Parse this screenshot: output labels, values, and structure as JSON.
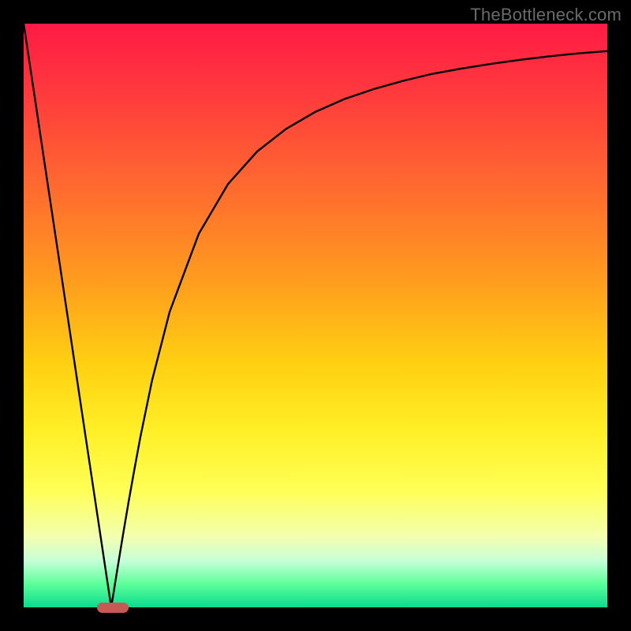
{
  "watermark": "TheBottleneck.com",
  "colors": {
    "frame": "#000000",
    "gradient_top": "#ff1a45",
    "gradient_bottom": "#0bdb8e",
    "curve": "#000000",
    "marker": "#c75955",
    "watermark": "#6a6a6a"
  },
  "chart_data": {
    "type": "line",
    "x": [
      0,
      2,
      4,
      6,
      8,
      10,
      12,
      14,
      15,
      16,
      17,
      18,
      19,
      20,
      22,
      25,
      30,
      35,
      40,
      45,
      50,
      55,
      60,
      65,
      70,
      75,
      80,
      85,
      90,
      95,
      100
    ],
    "values": [
      100,
      86.7,
      73.3,
      60.0,
      46.7,
      33.3,
      20.0,
      6.7,
      0.0,
      6.2,
      12.3,
      18.2,
      23.8,
      29.2,
      38.9,
      50.6,
      64.0,
      72.5,
      78.1,
      82.0,
      84.9,
      87.1,
      88.8,
      90.2,
      91.4,
      92.3,
      93.1,
      93.8,
      94.4,
      94.9,
      95.3
    ],
    "title": "",
    "xlabel": "",
    "ylabel": "",
    "xlim": [
      0,
      100
    ],
    "ylim": [
      0,
      100
    ],
    "legend": false,
    "grid": false,
    "marker": {
      "x_range": [
        12.5,
        18.0
      ],
      "y": 0
    }
  }
}
